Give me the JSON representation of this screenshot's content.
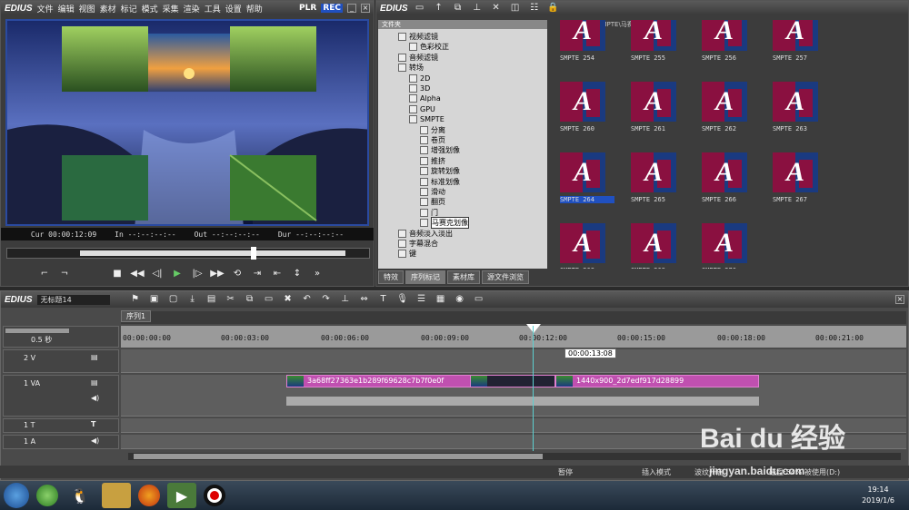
{
  "player": {
    "logo": "EDIUS",
    "menu": [
      "文件",
      "编辑",
      "视图",
      "素材",
      "标记",
      "模式",
      "采集",
      "渲染",
      "工具",
      "设置",
      "帮助"
    ],
    "plr": "PLR",
    "rec": "REC",
    "timecodes": {
      "cur_label": "Cur",
      "cur": "00:00:12:09",
      "in_label": "In",
      "in": "--:--:--:--",
      "out_label": "Out",
      "out": "--:--:--:--",
      "dur_label": "Dur",
      "dur": "--:--:--:--"
    }
  },
  "bin": {
    "logo": "EDIUS",
    "folder_label": "文件夹",
    "path": "\\特效\\转场\\SMPTE\\马赛克划像",
    "tree": [
      {
        "label": "视频滤镜",
        "indent": 1
      },
      {
        "label": "色彩校正",
        "indent": 2
      },
      {
        "label": "音频滤镜",
        "indent": 1
      },
      {
        "label": "转场",
        "indent": 1
      },
      {
        "label": "2D",
        "indent": 2
      },
      {
        "label": "3D",
        "indent": 2
      },
      {
        "label": "Alpha",
        "indent": 2
      },
      {
        "label": "GPU",
        "indent": 2
      },
      {
        "label": "SMPTE",
        "indent": 2
      },
      {
        "label": "分离",
        "indent": 3
      },
      {
        "label": "卷页",
        "indent": 3
      },
      {
        "label": "增强划像",
        "indent": 3
      },
      {
        "label": "推挤",
        "indent": 3
      },
      {
        "label": "旋转划像",
        "indent": 3
      },
      {
        "label": "标准划像",
        "indent": 3
      },
      {
        "label": "滑动",
        "indent": 3
      },
      {
        "label": "翻页",
        "indent": 3
      },
      {
        "label": "门",
        "indent": 3
      },
      {
        "label": "马赛克划像",
        "indent": 3
      },
      {
        "label": "音频淡入淡出",
        "indent": 1
      },
      {
        "label": "字幕混合",
        "indent": 1
      },
      {
        "label": "键",
        "indent": 1
      }
    ],
    "thumbs": [
      {
        "label": "SMPTE 254"
      },
      {
        "label": "SMPTE 255"
      },
      {
        "label": "SMPTE 256"
      },
      {
        "label": "SMPTE 257"
      },
      {
        "label": "SMPTE 260"
      },
      {
        "label": "SMPTE 261"
      },
      {
        "label": "SMPTE 262"
      },
      {
        "label": "SMPTE 263"
      },
      {
        "label": "SMPTE 264"
      },
      {
        "label": "SMPTE 265"
      },
      {
        "label": "SMPTE 266"
      },
      {
        "label": "SMPTE 267"
      },
      {
        "label": "SMPTE 268"
      },
      {
        "label": "SMPTE 269"
      },
      {
        "label": "SMPTE 270"
      }
    ],
    "thumb_letter": "A",
    "tabs": [
      "特效",
      "序列标记",
      "素材库",
      "源文件浏览"
    ]
  },
  "timeline": {
    "logo": "EDIUS",
    "project": "无标题14",
    "sequence_tab": "序列1",
    "zoom": "0.5 秒",
    "ruler_ticks": [
      "00:00:00:00",
      "00:00:03:00",
      "00:00:06:00",
      "00:00:09:00",
      "00:00:12:00",
      "00:00:15:00",
      "00:00:18:00",
      "00:00:21:00"
    ],
    "cursor_tooltip": "00:00:13:08",
    "tracks": {
      "v2": "2 V",
      "va1": "1 VA",
      "t1": "1 T",
      "a1": "1 A"
    },
    "clips": {
      "clip1": "3a68ff27363e1b289f69628c7b7f0e0f",
      "clip2": "1440x900_2d7edf917d28899"
    },
    "status": {
      "pause": "暂停",
      "insert": "插入模式",
      "ripple": "波纹开启",
      "disk": "磁盘:54% 被使用(D:)"
    }
  },
  "taskbar": {
    "time": "19:14",
    "date": "2019/1/6"
  },
  "watermark": {
    "brand": "Bai du 经验",
    "url": "jingyan.baidu.com"
  }
}
